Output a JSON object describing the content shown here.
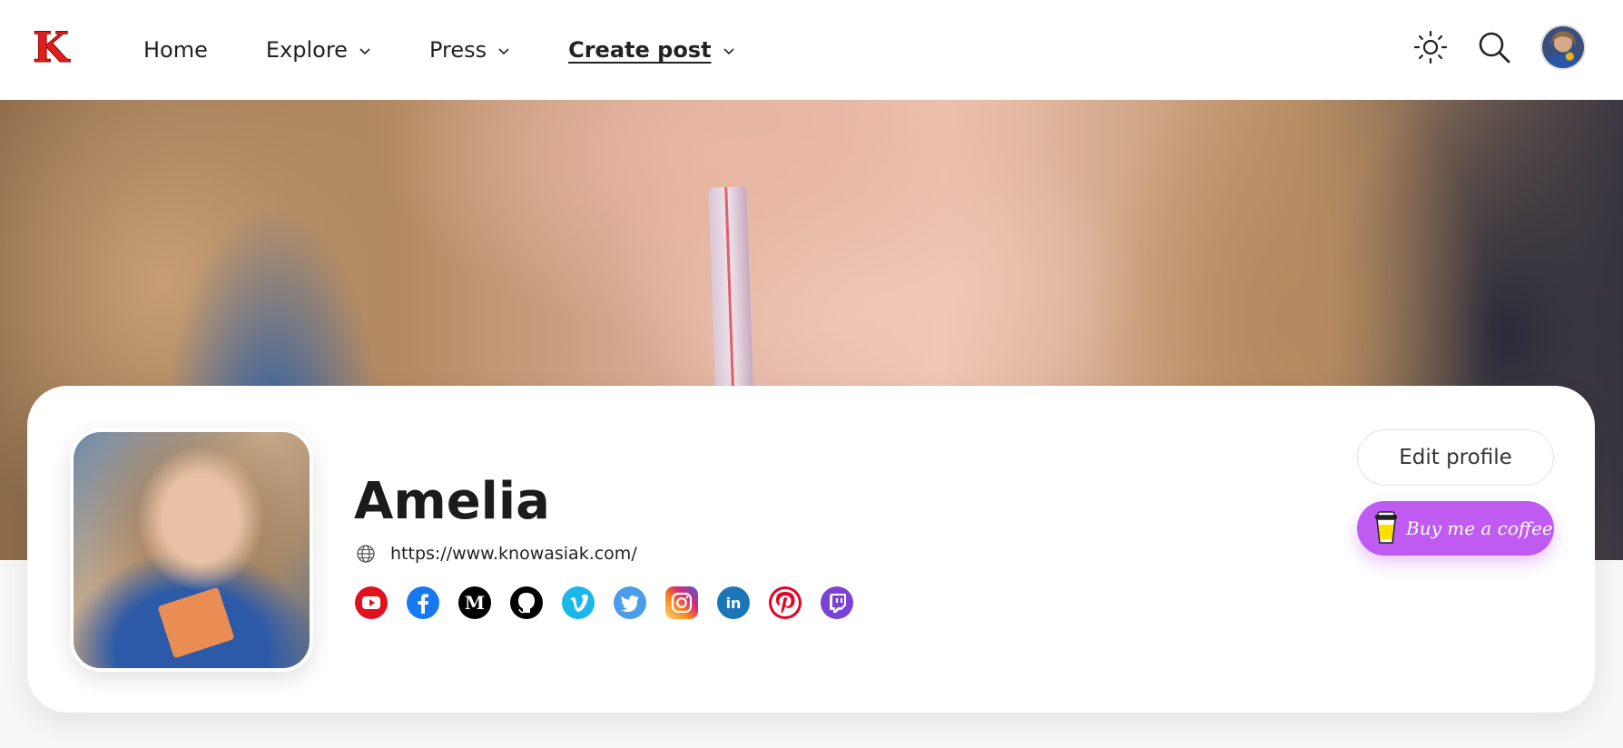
{
  "header": {
    "logo_icon": "k-logo-icon",
    "nav": [
      {
        "label": "Home",
        "has_dropdown": false
      },
      {
        "label": "Explore",
        "has_dropdown": true
      },
      {
        "label": "Press",
        "has_dropdown": true
      },
      {
        "label": "Create post",
        "has_dropdown": true,
        "active": true
      }
    ],
    "theme_icon": "sun-icon",
    "search_icon": "search-icon",
    "avatar_icon": "user-avatar"
  },
  "profile": {
    "name": "Amelia",
    "website": "https://www.knowasiak.com/",
    "edit_label": "Edit profile",
    "coffee_label": "Buy me a coffee",
    "socials": [
      {
        "name": "youtube",
        "color": "#e0101f"
      },
      {
        "name": "facebook",
        "color": "#1877f2"
      },
      {
        "name": "medium",
        "color": "#000000"
      },
      {
        "name": "github",
        "color": "#000000"
      },
      {
        "name": "vimeo",
        "color": "#1ab7ea"
      },
      {
        "name": "twitter",
        "color": "#1da1f2"
      },
      {
        "name": "instagram",
        "color": "#d62976"
      },
      {
        "name": "linkedin",
        "color": "#0a66c2"
      },
      {
        "name": "pinterest",
        "color": "#e60023"
      },
      {
        "name": "twitch",
        "color": "#9146ff"
      }
    ]
  },
  "colors": {
    "logo_red": "#e11d1d",
    "coffee_purple": "#bf5bf0",
    "text": "#1e1e1e"
  }
}
